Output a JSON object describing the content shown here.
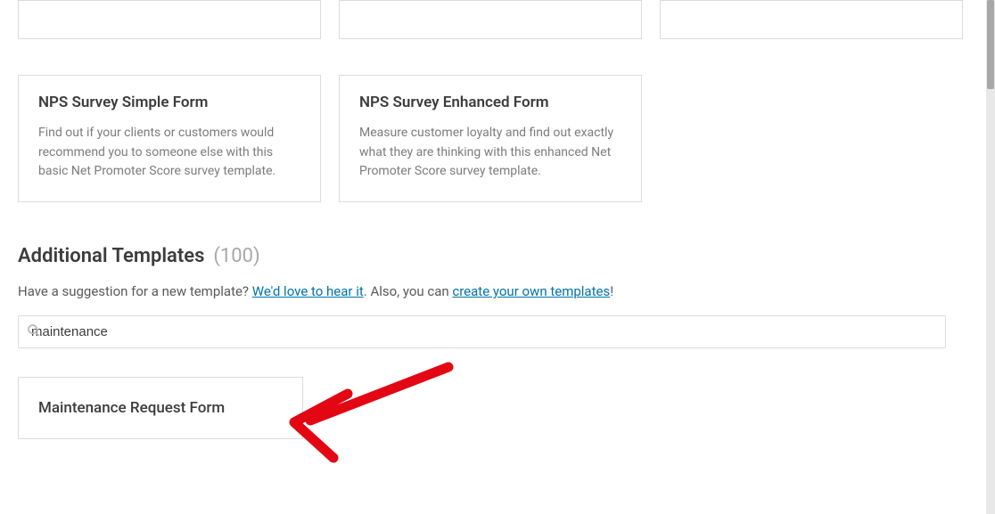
{
  "upper_cards": [
    {
      "title": "NPS Survey Simple Form",
      "desc": "Find out if your clients or customers would recommend you to someone else with this basic Net Promoter Score survey template."
    },
    {
      "title": "NPS Survey Enhanced Form",
      "desc": "Measure customer loyalty and find out exactly what they are thinking with this enhanced Net Promoter Score survey template."
    }
  ],
  "section": {
    "title": "Additional Templates",
    "count": "(100)",
    "sub_prefix": "Have a suggestion for a new template? ",
    "link1": "We'd love to hear it",
    "sub_mid": ". Also, you can ",
    "link2": "create your own templates",
    "sub_suffix": "!"
  },
  "search": {
    "value": "maintenance"
  },
  "result": {
    "title": "Maintenance Request Form"
  }
}
